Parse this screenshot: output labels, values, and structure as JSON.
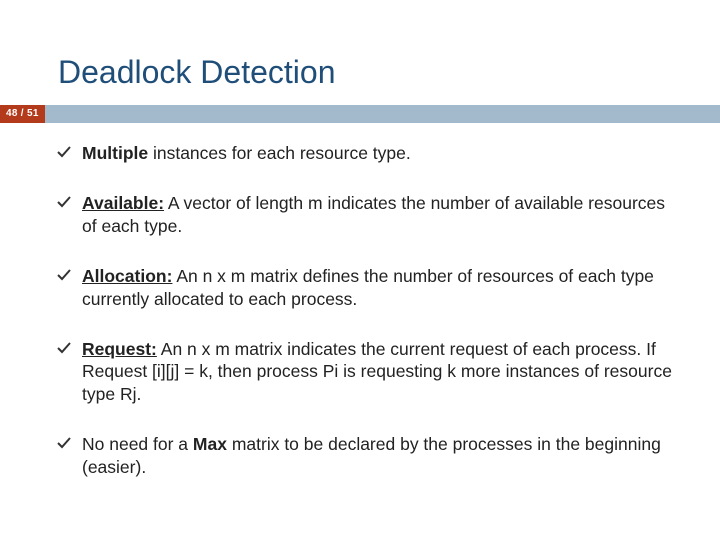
{
  "page_counter": "48 / 51",
  "title": "Deadlock Detection",
  "bullets": {
    "b0": {
      "bold": "Multiple",
      "rest": " instances for each resource type."
    },
    "b1": {
      "label": "Available:",
      "rest": " A vector of length m indicates the number of available resources of each type."
    },
    "b2": {
      "label": "Allocation:",
      "rest": " An n x m matrix defines the number of resources of each type currently allocated to each process."
    },
    "b3": {
      "label": "Request:",
      "rest": " An n x m matrix indicates the current request  of each process.  If Request [i][j] = k, then process Pi is requesting k more instances of resource type Rj."
    },
    "b4": {
      "pre": "No need for a ",
      "mid": "Max",
      "post": " matrix to be declared by the processes in the beginning (easier)."
    }
  }
}
